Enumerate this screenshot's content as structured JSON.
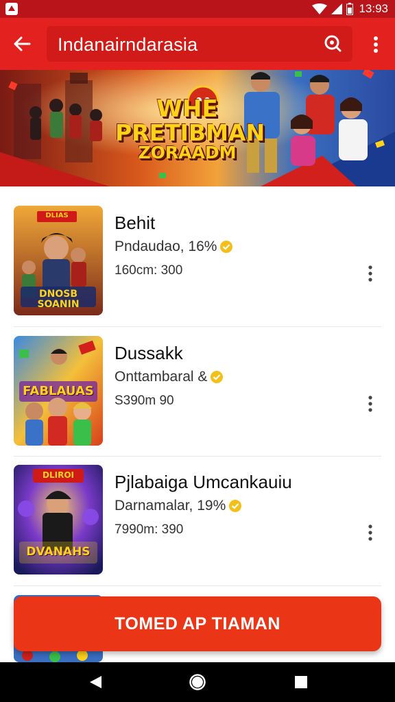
{
  "status_bar": {
    "time": "13:93",
    "icons": [
      "app-notification-icon",
      "wifi-icon",
      "signal-icon",
      "battery-icon"
    ]
  },
  "app_bar": {
    "title": "Indanairndarasia",
    "back_icon": "back-arrow-icon",
    "search_icon": "search-icon",
    "menu_icon": "more-vertical-icon",
    "color": "#e3211e"
  },
  "banner": {
    "title_line1": "WHE",
    "title_line2": "PRETIBMAN",
    "title_line3": "ZORAADM"
  },
  "items": [
    {
      "name": "Behit",
      "subtitle": "Pndaudao, 16%",
      "meta": "160cm: 300",
      "icon": "verified-badge-icon"
    },
    {
      "name": "Dussakk",
      "subtitle": "Onttambaral &",
      "meta": "S390m 90",
      "icon": "verified-badge-icon"
    },
    {
      "name": "Pjlabaiga Umcankauiu",
      "subtitle": "Darnamalar, 19%",
      "meta": "7990m: 390",
      "icon": "verified-badge-icon"
    }
  ],
  "thumbnails": [
    {
      "caption_top": "DLIAS",
      "caption_bottom": "DNOSB SOANIN"
    },
    {
      "caption_top": "",
      "caption_bottom": "FABLAUAS"
    },
    {
      "caption_top": "DLIROI",
      "caption_bottom": "DVANAHS"
    }
  ],
  "cta": {
    "label": "TOMED AP TIAMAN",
    "color": "#ea3617"
  },
  "nav_bar": {
    "icons": [
      "back-triangle-icon",
      "home-circle-icon",
      "recents-square-icon"
    ]
  }
}
